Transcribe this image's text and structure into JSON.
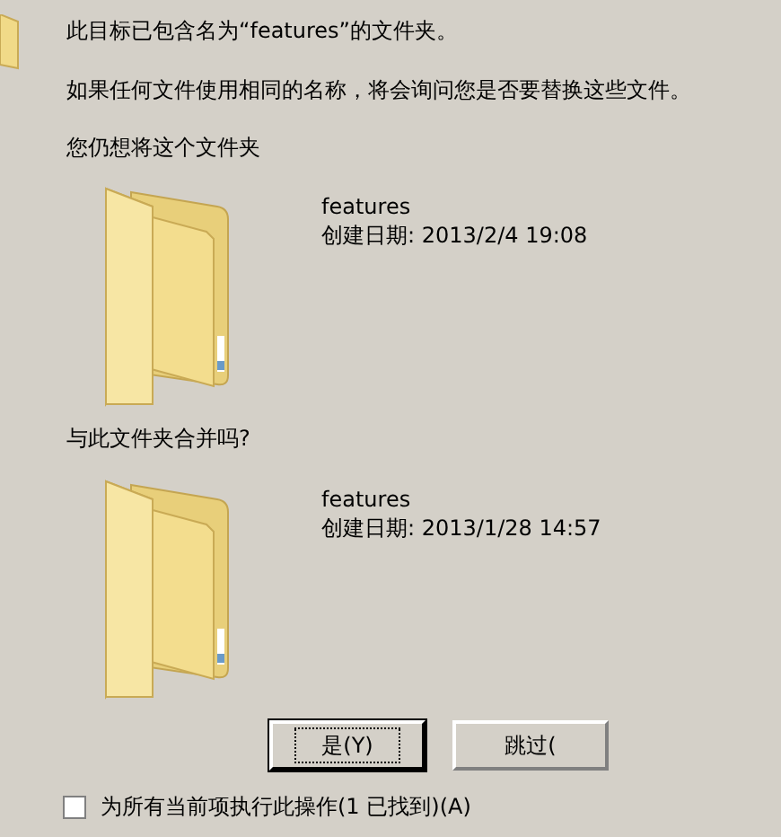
{
  "message": "此目标已包含名为“features”的文件夹。",
  "explanation": "如果任何文件使用相同的名称，将会询问您是否要替换这些文件。",
  "question_start": "您仍想将这个文件夹",
  "source_folder": {
    "name": "features",
    "created": "创建日期: 2013/2/4 19:08"
  },
  "question_end": "与此文件夹合并吗?",
  "target_folder": {
    "name": "features",
    "created": "创建日期: 2013/1/28 14:57"
  },
  "buttons": [
    {
      "label": "是(Y)",
      "focused": true
    },
    {
      "label": "跳过(",
      "focused": false
    }
  ],
  "apply_to_all": {
    "label": "为所有当前项执行此操作(1 已找到)(A)",
    "checked": false
  }
}
